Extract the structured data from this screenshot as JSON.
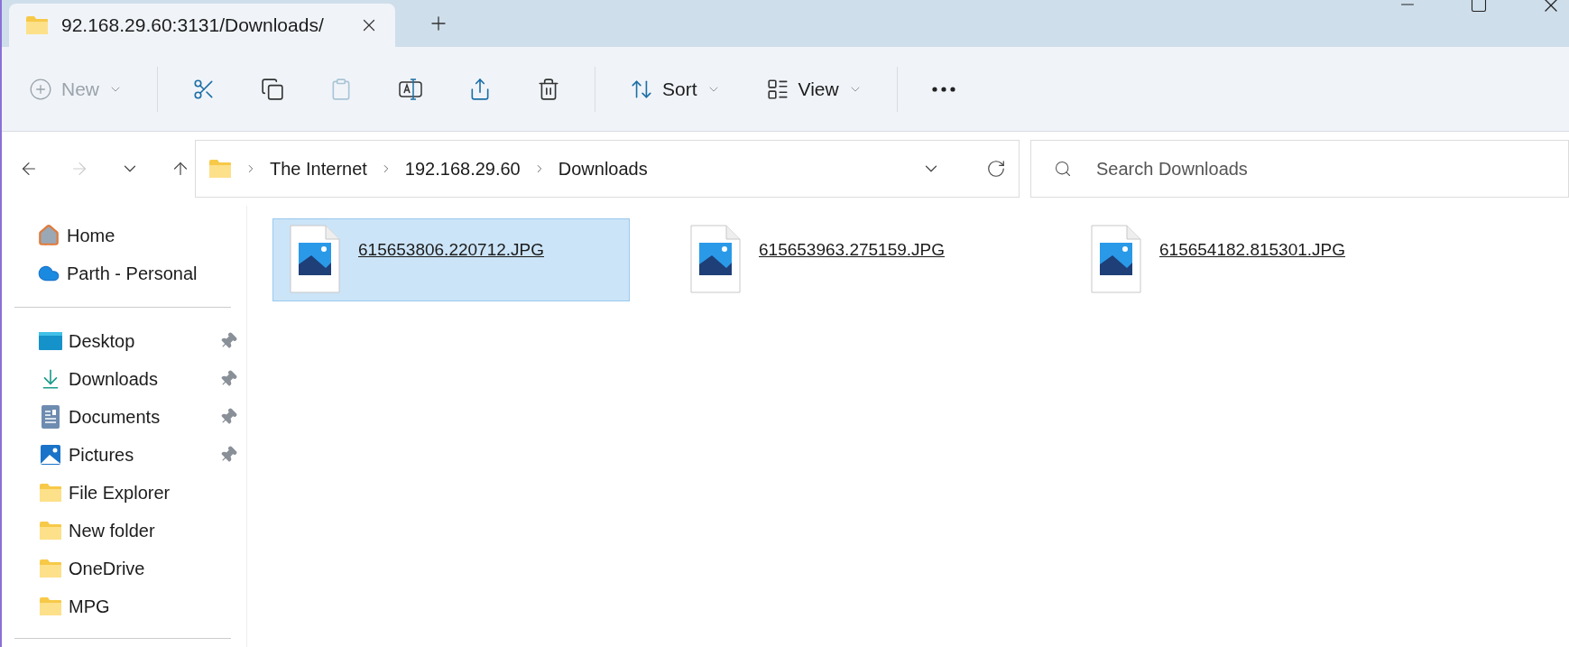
{
  "tab": {
    "title": "92.168.29.60:3131/Downloads/",
    "selected": true
  },
  "toolbar": [
    {
      "kind": "new",
      "label": "New",
      "disabled": true
    },
    {
      "kind": "cut",
      "disabled": false
    },
    {
      "kind": "copy",
      "disabled": false
    },
    {
      "kind": "paste",
      "disabled": true
    },
    {
      "kind": "rename",
      "disabled": false
    },
    {
      "kind": "share",
      "disabled": false
    },
    {
      "kind": "delete",
      "disabled": false
    },
    {
      "kind": "sort",
      "label": "Sort",
      "disabled": false
    },
    {
      "kind": "view",
      "label": "View",
      "disabled": false
    },
    {
      "kind": "more"
    }
  ],
  "navigation": [
    {
      "kind": "back",
      "disabled": false
    },
    {
      "kind": "forward",
      "disabled": true
    },
    {
      "kind": "recent",
      "disabled": false
    },
    {
      "kind": "up",
      "disabled": false
    }
  ],
  "breadcrumb": [
    "The Internet",
    "192.168.29.60",
    "Downloads"
  ],
  "search": {
    "placeholder": "Search Downloads"
  },
  "sidebar": {
    "top": [
      {
        "kind": "home",
        "label": "Home"
      },
      {
        "kind": "cloud",
        "label": "Parth - Personal"
      }
    ],
    "quick_access": [
      {
        "kind": "desktop",
        "label": "Desktop",
        "pinned": true
      },
      {
        "kind": "download",
        "label": "Downloads",
        "pinned": true
      },
      {
        "kind": "document",
        "label": "Documents",
        "pinned": true
      },
      {
        "kind": "picture",
        "label": "Pictures",
        "pinned": true
      },
      {
        "kind": "folder",
        "label": "File Explorer",
        "pinned": false
      },
      {
        "kind": "folder",
        "label": "New folder",
        "pinned": false
      },
      {
        "kind": "folder",
        "label": "OneDrive",
        "pinned": false
      },
      {
        "kind": "folder",
        "label": "MPG",
        "pinned": false
      }
    ]
  },
  "files": [
    {
      "name": "615653806.220712.JPG",
      "selected": true
    },
    {
      "name": "615653963.275159.JPG",
      "selected": false
    },
    {
      "name": "615654182.815301.JPG",
      "selected": false
    }
  ]
}
